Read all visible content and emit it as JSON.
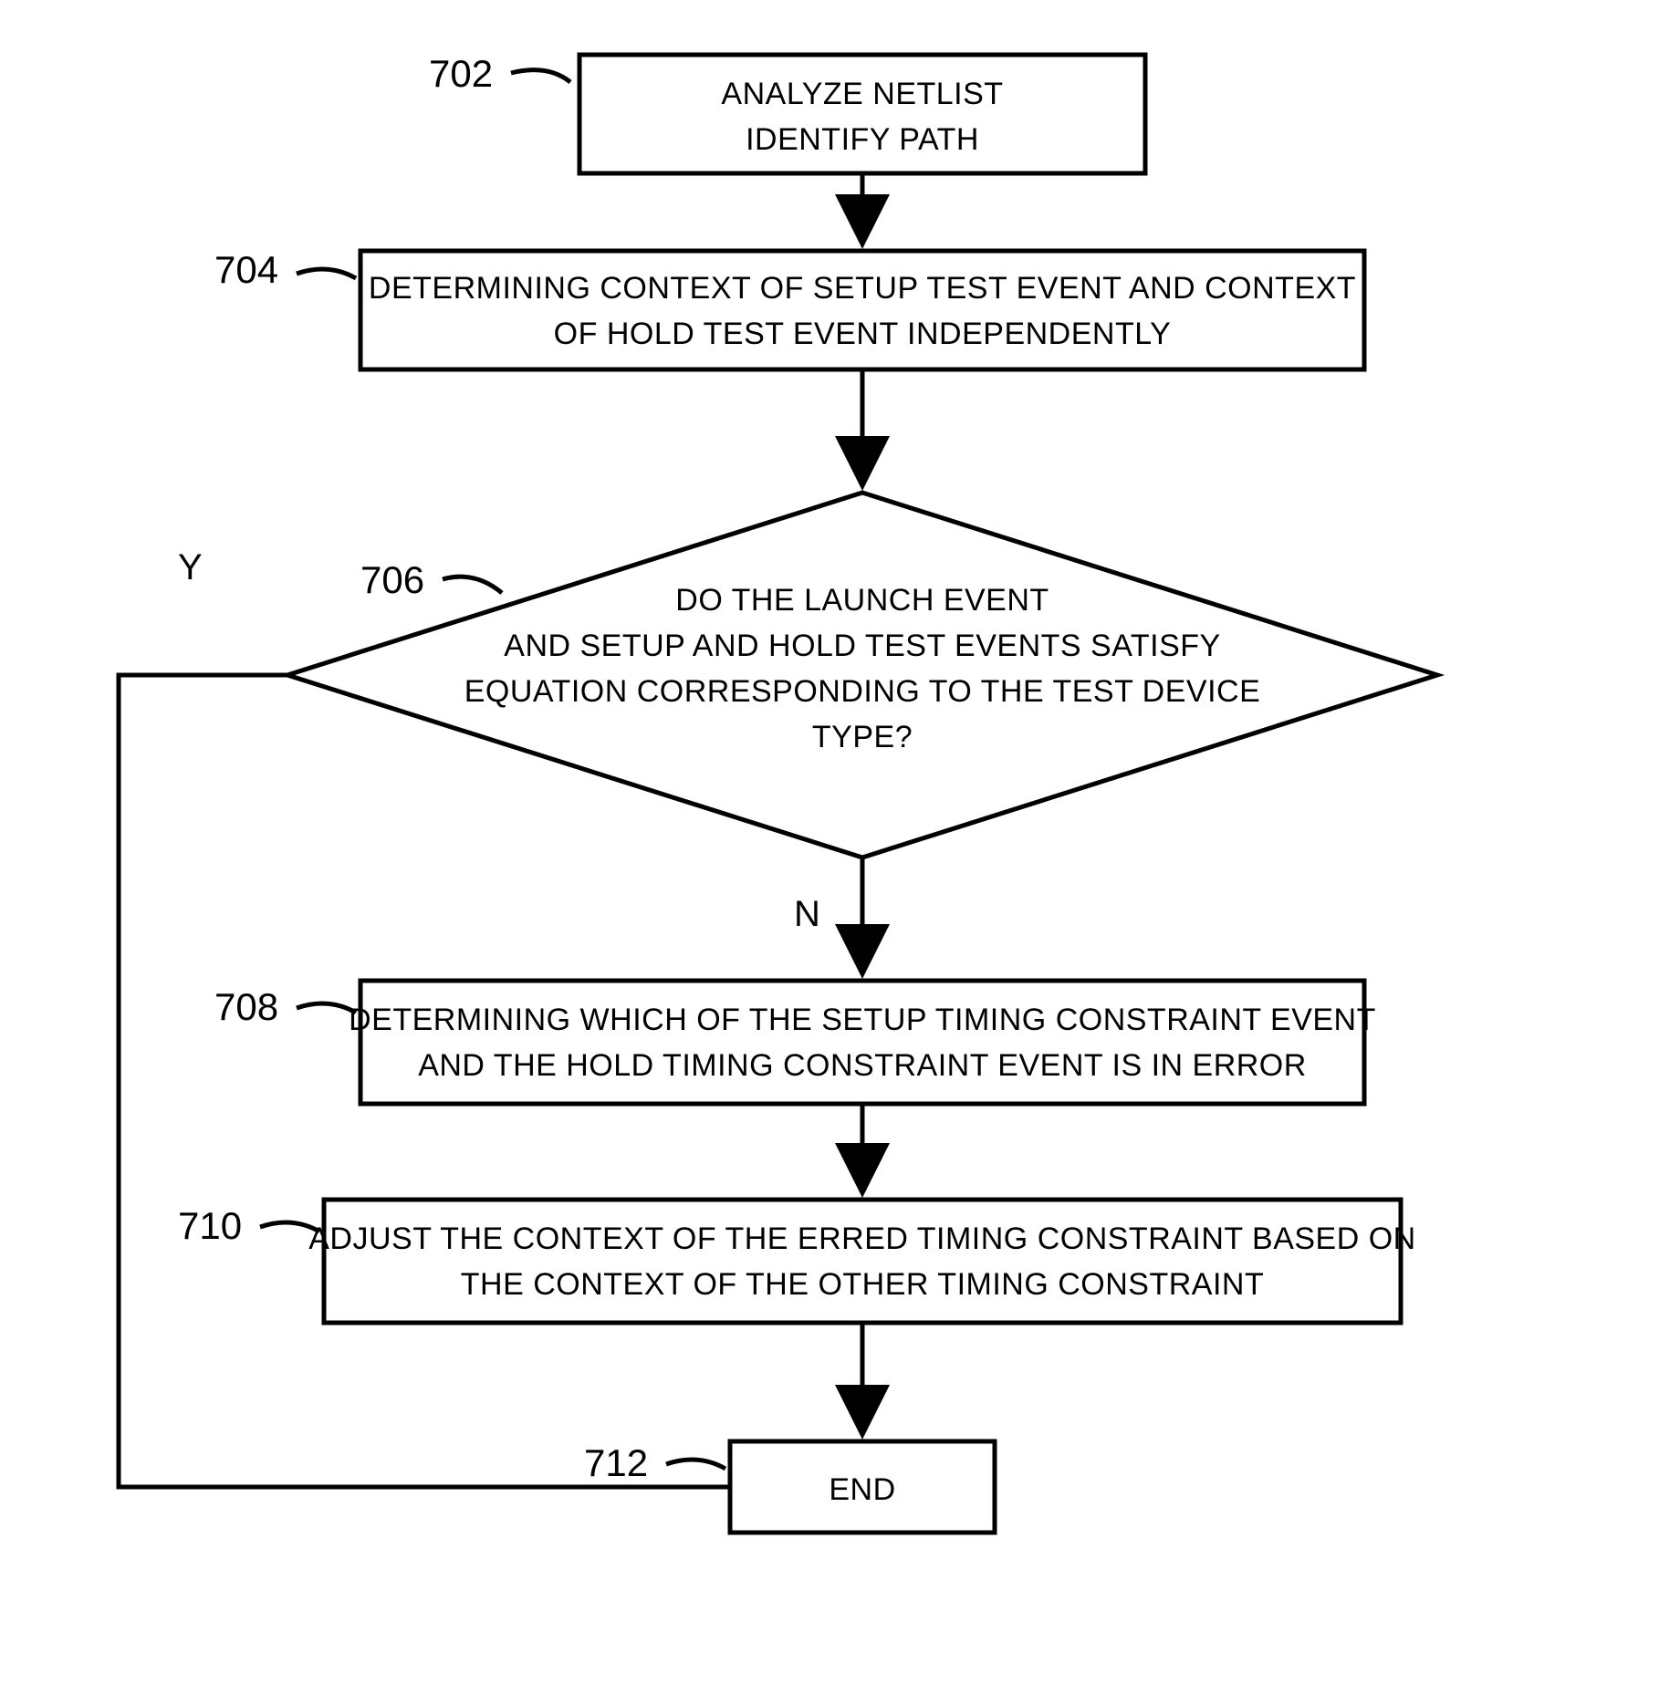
{
  "chart_data": {
    "type": "flowchart",
    "nodes": [
      {
        "id": "702",
        "label": "702",
        "type": "process",
        "lines": [
          "ANALYZE NETLIST",
          "IDENTIFY PATH"
        ]
      },
      {
        "id": "704",
        "label": "704",
        "type": "process",
        "lines": [
          "DETERMINING CONTEXT OF SETUP TEST EVENT AND CONTEXT",
          "OF HOLD TEST EVENT INDEPENDENTLY"
        ]
      },
      {
        "id": "706",
        "label": "706",
        "type": "decision",
        "lines": [
          "DO THE LAUNCH EVENT",
          "AND SETUP AND HOLD TEST EVENTS SATISFY",
          "EQUATION CORRESPONDING TO THE TEST DEVICE",
          "TYPE?"
        ]
      },
      {
        "id": "708",
        "label": "708",
        "type": "process",
        "lines": [
          "DETERMINING WHICH OF THE SETUP TIMING CONSTRAINT EVENT",
          "AND THE HOLD TIMING CONSTRAINT EVENT IS IN ERROR"
        ]
      },
      {
        "id": "710",
        "label": "710",
        "type": "process",
        "lines": [
          "ADJUST THE CONTEXT OF THE ERRED TIMING CONSTRAINT BASED ON",
          "THE CONTEXT OF THE OTHER TIMING CONSTRAINT"
        ]
      },
      {
        "id": "712",
        "label": "712",
        "type": "terminator",
        "lines": [
          "END"
        ]
      }
    ],
    "edges": [
      {
        "from": "702",
        "to": "704"
      },
      {
        "from": "704",
        "to": "706"
      },
      {
        "from": "706",
        "to": "708",
        "label": "N"
      },
      {
        "from": "706",
        "to": "712",
        "label": "Y"
      },
      {
        "from": "708",
        "to": "710"
      },
      {
        "from": "710",
        "to": "712"
      }
    ]
  },
  "labels": {
    "n702": "702",
    "n704": "704",
    "n706": "706",
    "n708": "708",
    "n710": "710",
    "n712": "712",
    "yes": "Y",
    "no": "N"
  },
  "text": {
    "b702_l1": "ANALYZE NETLIST",
    "b702_l2": "IDENTIFY PATH",
    "b704_l1": "DETERMINING CONTEXT OF SETUP TEST EVENT AND CONTEXT",
    "b704_l2": "OF HOLD TEST EVENT INDEPENDENTLY",
    "b706_l1": "DO THE LAUNCH EVENT",
    "b706_l2": "AND SETUP AND HOLD TEST EVENTS SATISFY",
    "b706_l3": "EQUATION CORRESPONDING TO THE TEST DEVICE",
    "b706_l4": "TYPE?",
    "b708_l1": "DETERMINING WHICH OF THE SETUP TIMING CONSTRAINT EVENT",
    "b708_l2": "AND THE HOLD TIMING CONSTRAINT EVENT IS IN ERROR",
    "b710_l1": "ADJUST THE CONTEXT OF THE ERRED TIMING CONSTRAINT BASED ON",
    "b710_l2": "THE CONTEXT OF THE OTHER TIMING CONSTRAINT",
    "b712_l1": "END"
  }
}
